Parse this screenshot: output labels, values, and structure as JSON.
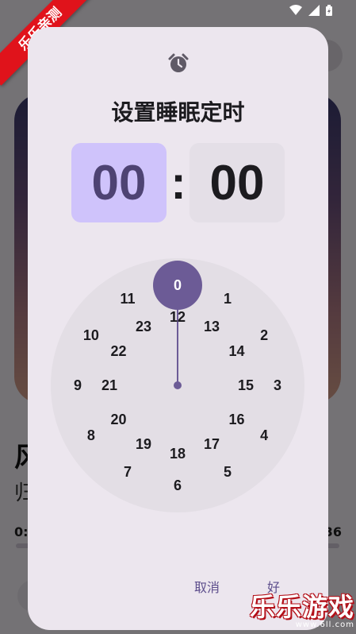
{
  "background_app": {
    "song_title": "风",
    "artist": "归",
    "elapsed": "0:",
    "total": "36"
  },
  "ribbon": "乐乐亲测",
  "dialog": {
    "icon": "alarm-icon",
    "title": "设置睡眠定时",
    "hour": "00",
    "separator": ":",
    "minute": "00",
    "selected_mode": "hour",
    "dial": {
      "selected": "0",
      "outer": [
        "0",
        "1",
        "2",
        "3",
        "4",
        "5",
        "6",
        "7",
        "8",
        "9",
        "10",
        "11"
      ],
      "inner": [
        "12",
        "13",
        "14",
        "15",
        "16",
        "17",
        "18",
        "19",
        "20",
        "21",
        "22",
        "23"
      ]
    },
    "cancel_label": "取消",
    "ok_label": "好"
  },
  "watermark": {
    "text": "乐乐游戏",
    "url": "www.6ll.com"
  },
  "colors": {
    "accent": "#6c5b96",
    "hour_box": "#cfc3fb",
    "dialog_bg": "#ece6ee",
    "ribbon": "#e0131b"
  }
}
